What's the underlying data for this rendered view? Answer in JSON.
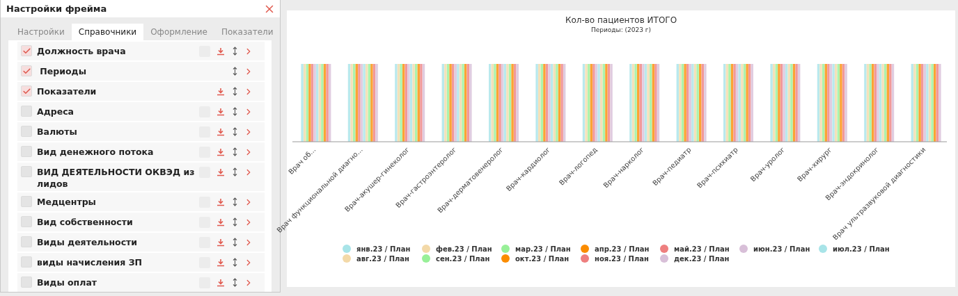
{
  "panel": {
    "title": "Настройки фрейма",
    "tabs": [
      {
        "label": "Настройки",
        "selected": false
      },
      {
        "label": "Справочники",
        "selected": true
      },
      {
        "label": "Оформление",
        "selected": false
      },
      {
        "label": "Показатели",
        "selected": false
      }
    ],
    "items": [
      {
        "label": "Должность врача",
        "checked": true,
        "toggle_box": true,
        "download": true
      },
      {
        "label": " Периоды",
        "checked": true,
        "toggle_box": false,
        "download": false
      },
      {
        "label": "Показатели",
        "checked": true,
        "toggle_box": false,
        "download": true
      },
      {
        "label": "Адреса",
        "checked": false,
        "toggle_box": true,
        "download": true
      },
      {
        "label": "Валюты",
        "checked": false,
        "toggle_box": true,
        "download": true
      },
      {
        "label": "Вид денежного потока",
        "checked": false,
        "toggle_box": true,
        "download": true
      },
      {
        "label": "ВИД ДЕЯТЕЛЬНОСТИ ОКВЭД из лидов",
        "checked": false,
        "toggle_box": true,
        "download": true
      },
      {
        "label": "Медцентры",
        "checked": false,
        "toggle_box": true,
        "download": true
      },
      {
        "label": "Вид собственности",
        "checked": false,
        "toggle_box": true,
        "download": true
      },
      {
        "label": "Виды деятельности",
        "checked": false,
        "toggle_box": true,
        "download": true
      },
      {
        "label": "виды начисления ЗП",
        "checked": false,
        "toggle_box": true,
        "download": true
      },
      {
        "label": "Виды оплат",
        "checked": false,
        "toggle_box": true,
        "download": true
      }
    ]
  },
  "chart": {
    "title": "Кол-во пациентов ИТОГО",
    "subtitle": "Периоды: (2023 г)",
    "categories": [
      "Врач об...",
      "Врач функциональной диагно...",
      "Врач-акушер-гинеколог",
      "Врач-гастроэнтеролог",
      "Врач-дерматовенеролог",
      "Врач-кардиолог",
      "Врач-логопед",
      "Врач-нарколог",
      "Врач-педиатр",
      "Врач-психиатр",
      "Врач-уролог",
      "Врач-хирург",
      "Врач-эндокринолог",
      "Врач ультразвуковой диагностики"
    ],
    "legend": [
      {
        "label": "янв.23 / План",
        "color": "#a8e4e8"
      },
      {
        "label": "фев.23 / План",
        "color": "#f3d9a8"
      },
      {
        "label": "мар.23 / План",
        "color": "#98f098"
      },
      {
        "label": "апр.23 / План",
        "color": "#fb8c00"
      },
      {
        "label": "май.23 / План",
        "color": "#ee7f7f"
      },
      {
        "label": "июн.23 / План",
        "color": "#d8bfd8"
      },
      {
        "label": "июл.23 / План",
        "color": "#a8e4e8"
      },
      {
        "label": "авг.23 / План",
        "color": "#f3d9a8"
      },
      {
        "label": "сен.23 / План",
        "color": "#98f098"
      },
      {
        "label": "окт.23 / План",
        "color": "#fb8c00"
      },
      {
        "label": "ноя.23 / План",
        "color": "#ee7f7f"
      },
      {
        "label": "дек.23 / План",
        "color": "#d8bfd8"
      }
    ]
  }
}
